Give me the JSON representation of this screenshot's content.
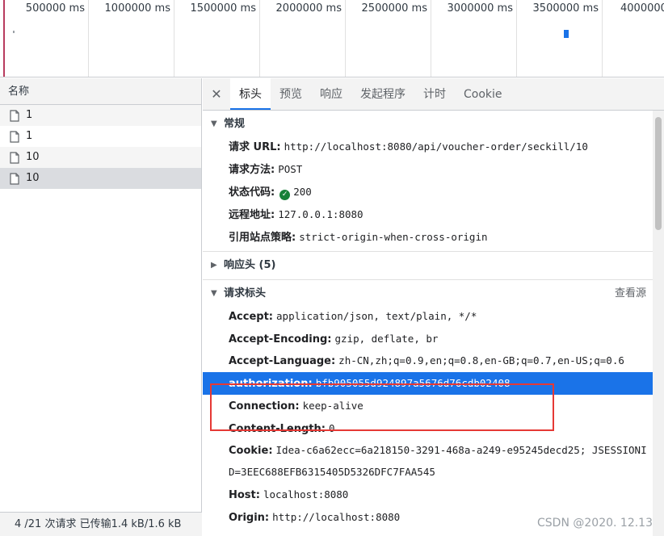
{
  "timeline": {
    "ticks": [
      "500000 ms",
      "1000000 ms",
      "1500000 ms",
      "2000000 ms",
      "2500000 ms",
      "3000000 ms",
      "3500000 ms",
      "4000000"
    ]
  },
  "name_panel": {
    "header": "名称",
    "rows": [
      {
        "name": "1"
      },
      {
        "name": "1"
      },
      {
        "name": "10"
      },
      {
        "name": "10"
      }
    ],
    "status": "4 /21 次请求  已传输1.4 kB/1.6 kB"
  },
  "tabs": {
    "close_icon": "close-icon",
    "items": [
      "标头",
      "预览",
      "响应",
      "发起程序",
      "计时",
      "Cookie"
    ],
    "active": "标头"
  },
  "general": {
    "title": "常规",
    "request_url_label": "请求 URL:",
    "request_url": "http://localhost:8080/api/voucher-order/seckill/10",
    "method_label": "请求方法:",
    "method": "POST",
    "status_label": "状态代码:",
    "status": "200",
    "remote_label": "远程地址:",
    "remote": "127.0.0.1:8080",
    "referrer_label": "引用站点策略:",
    "referrer": "strict-origin-when-cross-origin"
  },
  "response_headers": {
    "title": "响应头 (5)"
  },
  "request_headers": {
    "title": "请求标头",
    "view_source": "查看源",
    "items": [
      {
        "key": "Accept:",
        "value": "application/json, text/plain, */*"
      },
      {
        "key": "Accept-Encoding:",
        "value": "gzip, deflate, br"
      },
      {
        "key": "Accept-Language:",
        "value": "zh-CN,zh;q=0.9,en;q=0.8,en-GB;q=0.7,en-US;q=0.6"
      },
      {
        "key": "authorization:",
        "value": "bfb905055d924897a5676d76cdb02408"
      },
      {
        "key": "Connection:",
        "value": "keep-alive"
      },
      {
        "key": "Content-Length:",
        "value": "0"
      },
      {
        "key": "Cookie:",
        "value": "Idea-c6a62ecc=6a218150-3291-468a-a249-e95245decd25; JSESSIONID=3EEC688EFB6315405D5326DFC7FAA545"
      },
      {
        "key": "Host:",
        "value": "localhost:8080"
      },
      {
        "key": "Origin:",
        "value": "http://localhost:8080"
      }
    ]
  },
  "watermark": "CSDN @2020. 12.13",
  "colors": {
    "accent": "#1a73e8",
    "annotation": "#e53935",
    "status_ok": "#188038"
  }
}
